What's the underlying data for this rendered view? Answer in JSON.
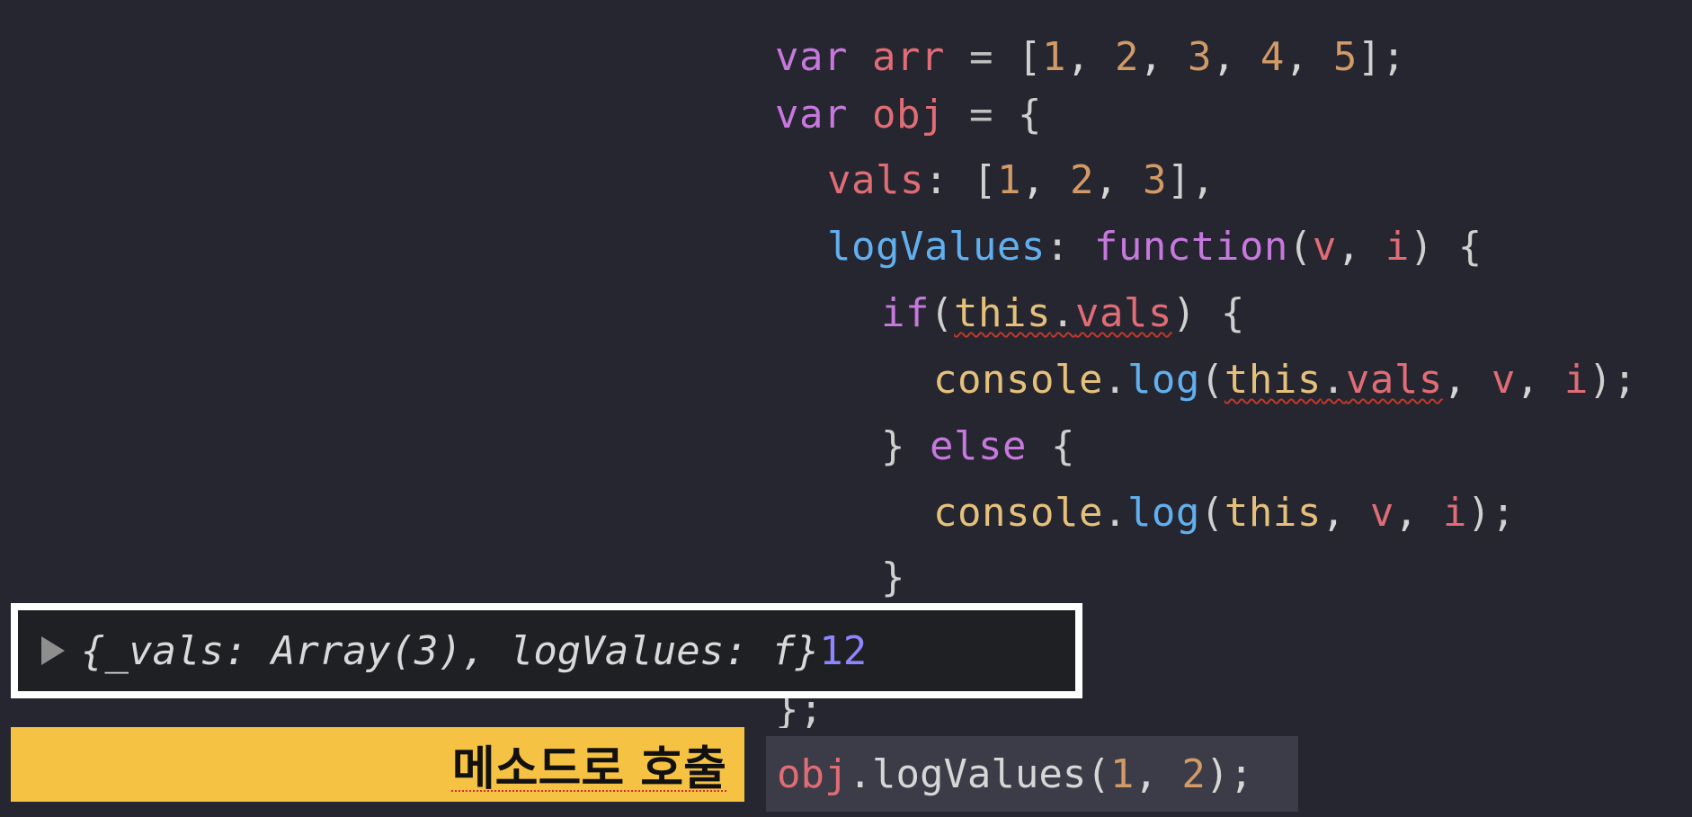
{
  "code": {
    "line1": {
      "kw": "var",
      "name": "arr",
      "eq": "=",
      "open": "[",
      "n1": "1",
      "n2": "2",
      "n3": "3",
      "n4": "4",
      "n5": "5",
      "close": "];"
    },
    "line2": {
      "kw": "var",
      "name": "obj",
      "eq": "=",
      "open": "{"
    },
    "line3": {
      "prop": "vals",
      "sep": ":",
      "open": "[",
      "n1": "1",
      "n2": "2",
      "n3": "3",
      "close": "],"
    },
    "line4": {
      "prop": "logValues",
      "sep": ":",
      "kw": "function",
      "open": "(",
      "p1": "v",
      "p2": "i",
      "close": ") {"
    },
    "line5": {
      "kw": "if",
      "open": "(",
      "this": "this",
      "dot": ".",
      "prop": "vals",
      "close": ") {"
    },
    "line6": {
      "obj": "console",
      "dot": ".",
      "fn": "log",
      "open": "(",
      "this": "this",
      "dot2": ".",
      "prop": "vals",
      "p1": "v",
      "p2": "i",
      "close": ");"
    },
    "line7": {
      "brace": "}",
      "kw": "else",
      "open": "{"
    },
    "line8": {
      "obj": "console",
      "dot": ".",
      "fn": "log",
      "open": "(",
      "this": "this",
      "p1": "v",
      "p2": "i",
      "close": ");"
    },
    "line9": {
      "brace": "}"
    },
    "line10": {
      "text": "};"
    }
  },
  "console_output": {
    "object_text": "{_vals: Array(3), logValues: f}",
    "arg1": "1",
    "arg2": "2"
  },
  "label": {
    "text": "메소드로 호출"
  },
  "call": {
    "obj": "obj",
    "rest": ".logValues(",
    "a1": "1",
    "comma": ", ",
    "a2": "2",
    "close": ");"
  },
  "colors": {
    "background": "#25262f",
    "keyword": "#c678dd",
    "variable": "#e06c75",
    "number": "#d19a66",
    "property": "#61afef",
    "highlight_label": "#f6c243",
    "console_arg": "#8f86ff"
  }
}
